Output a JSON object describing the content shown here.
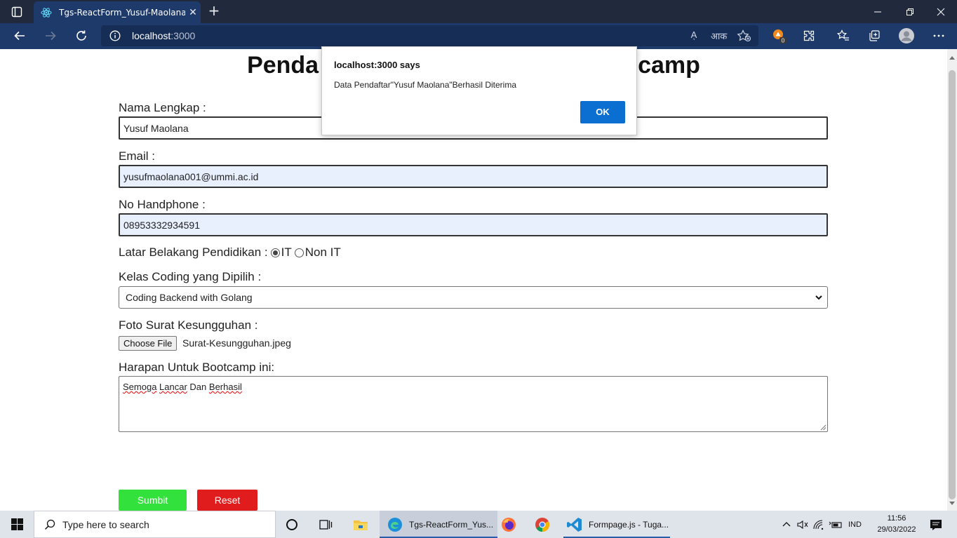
{
  "browser": {
    "tab_title": "Tgs-ReactForm_Yusuf-Maolana",
    "url_host": "localhost",
    "url_port": ":3000",
    "read_aloud_icon_text": "Aͅ",
    "translate_icon_text": "आक",
    "extensions_badge": "0"
  },
  "page": {
    "heading_left": "Penda",
    "heading_right": "camp",
    "name_label": "Nama Lengkap :",
    "name_value": "Yusuf Maolana",
    "email_label": "Email :",
    "email_value": "yusufmaolana001@ummi.ac.id",
    "phone_label": "No Handphone :",
    "phone_value": "08953332934591",
    "education_label": "Latar Belakang Pendidikan :",
    "education_options": [
      "IT",
      "Non IT"
    ],
    "education_selected": "IT",
    "class_label": "Kelas Coding yang Dipilih :",
    "class_value": "Coding Backend with Golang",
    "photo_label": "Foto Surat Kesungguhan :",
    "choose_file_label": "Choose File",
    "file_name": "Surat-Kesungguhan.jpeg",
    "hope_label": "Harapan Untuk Bootcamp ini:",
    "hope_words": [
      "Semoga",
      "Lancar",
      "Dan",
      "Berhasil"
    ],
    "submit_label": "Sumbit",
    "reset_label": "Reset"
  },
  "dialog": {
    "title": "localhost:3000 says",
    "message": "Data Pendaftar\"Yusuf Maolana\"Berhasil Diterima",
    "ok_label": "OK"
  },
  "taskbar": {
    "search_placeholder": "Type here to search",
    "edge_app_label": "Tgs-ReactForm_Yus...",
    "vscode_app_label": "Formpage.js - Tuga...",
    "language": "IND",
    "time": "11:56",
    "date": "29/03/2022"
  },
  "colors": {
    "titlebar": "#202a3c",
    "navbar": "#1e3a6b",
    "submit": "#32e13c",
    "reset": "#e11c1c",
    "dialog_ok": "#0a6fd1"
  }
}
